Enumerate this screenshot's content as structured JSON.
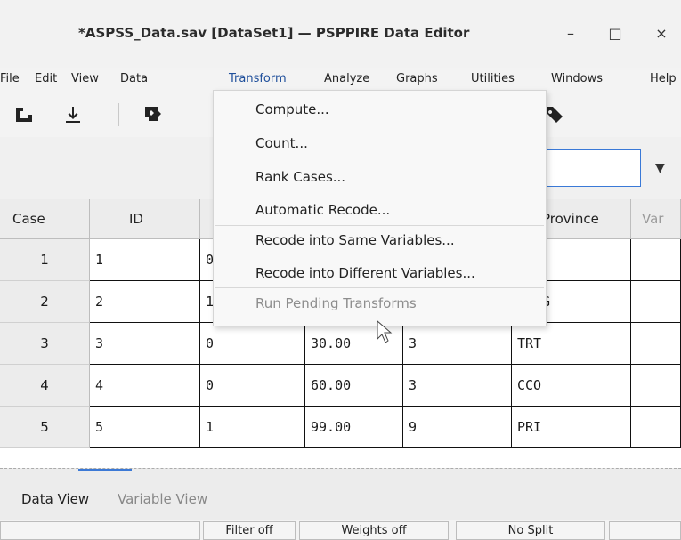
{
  "window": {
    "title": "*ASPSS_Data.sav [DataSet1] — PSPPIRE Data Editor",
    "controls": [
      "–",
      "□",
      "×"
    ]
  },
  "menubar": {
    "items": [
      "File",
      "Edit",
      "View",
      "Data",
      "Transform",
      "Analyze",
      "Graphs",
      "Utilities",
      "Windows",
      "Help"
    ]
  },
  "dropdown": {
    "items": [
      "Compute...",
      "Count...",
      "Rank Cases...",
      "Automatic Recode...",
      "Recode into Same Variables...",
      "Recode into Different Variables...",
      "Run Pending Transforms"
    ]
  },
  "grid": {
    "headers": [
      "Case",
      "ID",
      "",
      "",
      "",
      "Province",
      "Var"
    ],
    "rows": [
      {
        "case": "1",
        "id": "1",
        "c2": "0",
        "c3": "",
        "c4": "",
        "c5": ""
      },
      {
        "case": "2",
        "id": "2",
        "c2": "1",
        "c3": "",
        "c4": "",
        "c5": "G"
      },
      {
        "case": "3",
        "id": "3",
        "c2": "0",
        "c3": "30.00",
        "c4": "3",
        "c5": "TRT"
      },
      {
        "case": "4",
        "id": "4",
        "c2": "0",
        "c3": "60.00",
        "c4": "3",
        "c5": "CCO"
      },
      {
        "case": "5",
        "id": "5",
        "c2": "1",
        "c3": "99.00",
        "c4": "9",
        "c5": "PRI"
      }
    ]
  },
  "tabs": {
    "active": "Data View",
    "inactive": "Variable View"
  },
  "status": {
    "filter": "Filter off",
    "weights": "Weights off",
    "split": "No Split"
  },
  "icons": {
    "toolbar": [
      "open-icon",
      "save-icon",
      "goto-icon",
      "tag-icon"
    ]
  },
  "colors": {
    "accent": "#3b79d6",
    "menu_active": "#1f4f9b"
  }
}
